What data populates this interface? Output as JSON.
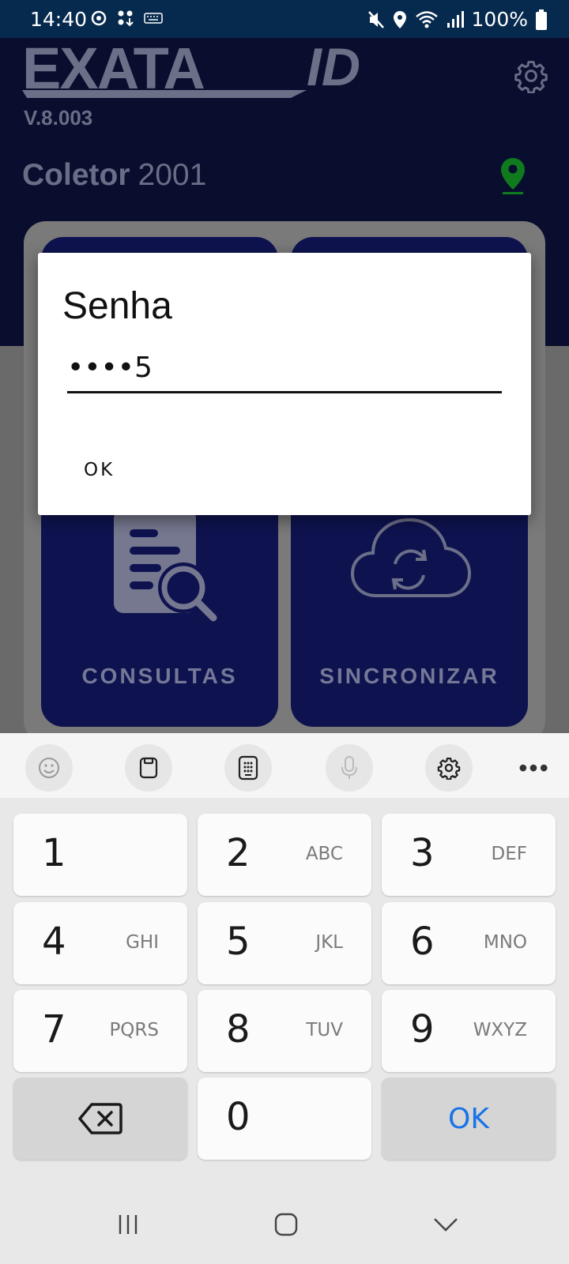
{
  "status_bar": {
    "time": "14:40",
    "battery_text": "100%"
  },
  "app": {
    "logo_text": "EXATA",
    "logo_suffix": "ID",
    "version": "V.8.003",
    "coletor_label": "Coletor",
    "coletor_number": "2001",
    "tiles": [
      {
        "label": "CONSULTAS",
        "icon": "document-search-icon"
      },
      {
        "label": "SINCRONIZAR",
        "icon": "cloud-sync-icon"
      }
    ]
  },
  "dialog": {
    "title": "Senha",
    "input_value": "••••5",
    "ok_label": "OK"
  },
  "keyboard": {
    "toolbar_icons": [
      "emoji-icon",
      "clipboard-icon",
      "keypad-icon",
      "microphone-icon",
      "gear-icon",
      "more-icon"
    ],
    "more_label": "•••",
    "keys": [
      {
        "num": "1",
        "letters": ""
      },
      {
        "num": "2",
        "letters": "ABC"
      },
      {
        "num": "3",
        "letters": "DEF"
      },
      {
        "num": "4",
        "letters": "GHI"
      },
      {
        "num": "5",
        "letters": "JKL"
      },
      {
        "num": "6",
        "letters": "MNO"
      },
      {
        "num": "7",
        "letters": "PQRS"
      },
      {
        "num": "8",
        "letters": "TUV"
      },
      {
        "num": "9",
        "letters": "WXYZ"
      }
    ],
    "zero": "0",
    "ok_label": "OK"
  },
  "colors": {
    "header_bg": "#0a0e2e",
    "tile_bg": "#0e1350",
    "status_bar_bg": "#062a4e",
    "keyboard_ok": "#1a73e8",
    "location_pin": "#0f7a1e"
  }
}
